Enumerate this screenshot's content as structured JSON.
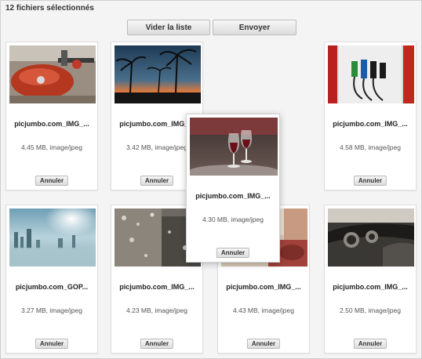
{
  "header": {
    "title": "12 fichiers sélectionnés"
  },
  "toolbar": {
    "clear_label": "Vider la liste",
    "send_label": "Envoyer"
  },
  "cancel_label": "Annuler",
  "files": [
    {
      "name": "picjumbo.com_IMG_...",
      "meta": "4.45 MB, image/jpeg",
      "image": "motorcycle-tank-photo"
    },
    {
      "name": "picjumbo.com_IMG_...",
      "meta": "3.42 MB, image/jpeg",
      "image": "palm-sunset-photo"
    },
    {
      "name": "picjumbo.com_IMG_...",
      "meta": "4.30 MB, image/jpeg",
      "image": "wine-glasses-photo"
    },
    {
      "name": "picjumbo.com_IMG_...",
      "meta": "4.58 MB, image/jpeg",
      "image": "fuel-pump-photo"
    },
    {
      "name": "picjumbo.com_GOP...",
      "meta": "3.27 MB, image/jpeg",
      "image": "foggy-city-photo"
    },
    {
      "name": "picjumbo.com_IMG_...",
      "meta": "4.23 MB, image/jpeg",
      "image": "rain-window-photo"
    },
    {
      "name": "picjumbo.com_IMG_...",
      "meta": "4.43 MB, image/jpeg",
      "image": "cafe-table-photo"
    },
    {
      "name": "picjumbo.com_IMG_...",
      "meta": "2.50 MB, image/jpeg",
      "image": "car-dashboard-photo"
    }
  ]
}
